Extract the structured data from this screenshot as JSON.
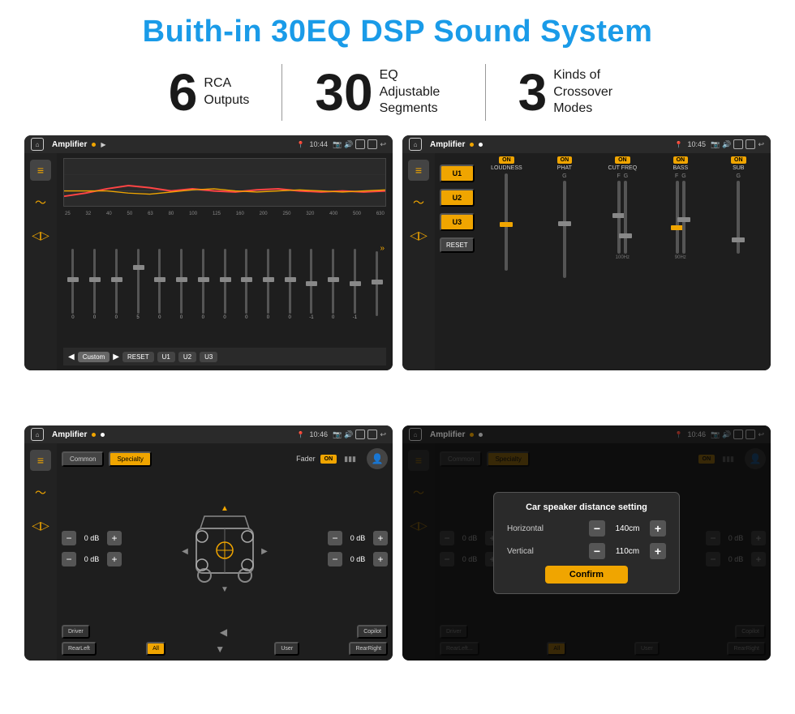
{
  "main_title": "Buith-in 30EQ DSP Sound System",
  "stats": [
    {
      "number": "6",
      "text": "RCA\nOutputs"
    },
    {
      "number": "30",
      "text": "EQ Adjustable\nSegments"
    },
    {
      "number": "3",
      "text": "Kinds of\nCrossover Modes"
    }
  ],
  "screens": [
    {
      "id": "eq-screen",
      "status_bar": {
        "app": "Amplifier",
        "time": "10:44"
      },
      "type": "eq"
    },
    {
      "id": "crossover-screen",
      "status_bar": {
        "app": "Amplifier",
        "time": "10:45"
      },
      "type": "crossover"
    },
    {
      "id": "fader-screen",
      "status_bar": {
        "app": "Amplifier",
        "time": "10:46"
      },
      "type": "fader"
    },
    {
      "id": "dialog-screen",
      "status_bar": {
        "app": "Amplifier",
        "time": "10:46"
      },
      "type": "dialog"
    }
  ],
  "eq": {
    "frequencies": [
      "25",
      "32",
      "40",
      "50",
      "63",
      "80",
      "100",
      "125",
      "160",
      "200",
      "250",
      "320",
      "400",
      "500",
      "630"
    ],
    "values": [
      "0",
      "0",
      "0",
      "5",
      "0",
      "0",
      "0",
      "0",
      "0",
      "0",
      "0",
      "-1",
      "0",
      "-1",
      ""
    ],
    "buttons": [
      "Custom",
      "RESET",
      "U1",
      "U2",
      "U3"
    ]
  },
  "crossover": {
    "u_buttons": [
      "U1",
      "U2",
      "U3"
    ],
    "channels": [
      {
        "on": true,
        "label": "LOUDNESS"
      },
      {
        "on": true,
        "label": "PHAT"
      },
      {
        "on": true,
        "label": "CUT FREQ"
      },
      {
        "on": true,
        "label": "BASS"
      },
      {
        "on": true,
        "label": "SUB"
      }
    ]
  },
  "fader": {
    "tabs": [
      "Common",
      "Specialty"
    ],
    "active_tab": "Specialty",
    "fader_label": "Fader",
    "fader_on": "ON",
    "db_rows": [
      {
        "label": "0 dB",
        "value": "0 dB"
      },
      {
        "label": "0 dB",
        "value": "0 dB"
      },
      {
        "label": "0 dB",
        "value": "0 dB"
      },
      {
        "label": "0 dB",
        "value": "0 dB"
      }
    ],
    "bottom_buttons": [
      "Driver",
      "",
      "Copilot",
      "RearLeft",
      "All",
      "",
      "User",
      "RearRight"
    ]
  },
  "dialog": {
    "title": "Car speaker distance setting",
    "horizontal_label": "Horizontal",
    "horizontal_value": "140cm",
    "vertical_label": "Vertical",
    "vertical_value": "110cm",
    "confirm_label": "Confirm"
  }
}
